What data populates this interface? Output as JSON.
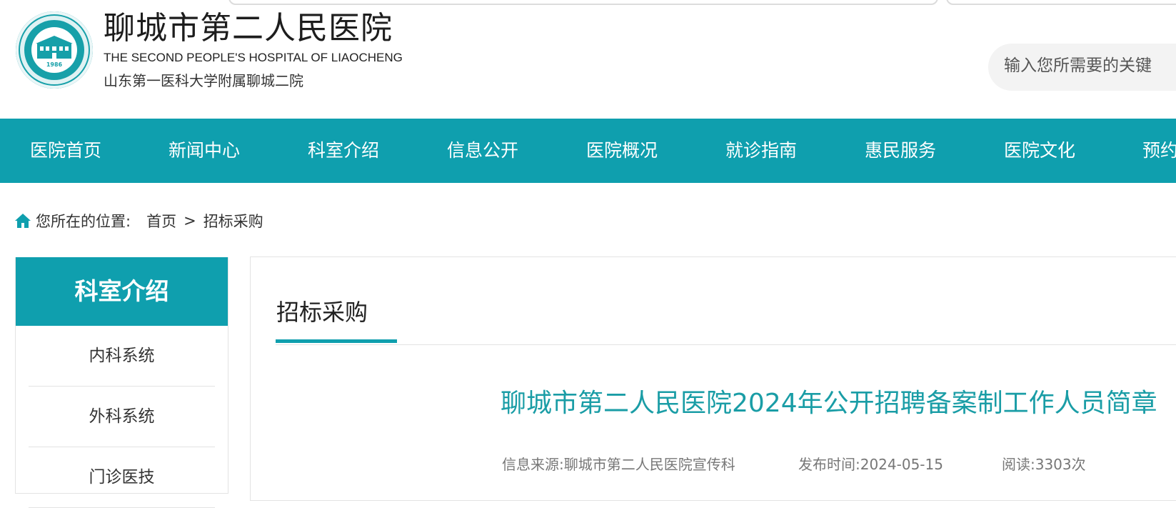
{
  "header": {
    "site_name": "聊城市第二人民医院",
    "site_name_en": "THE SECOND PEOPLE'S HOSPITAL OF LIAOCHENG",
    "site_subtitle": "山东第一医科大学附属聊城二院",
    "logo_year": "1986",
    "search_placeholder": "输入您所需要的关键"
  },
  "nav": {
    "items": [
      "医院首页",
      "新闻中心",
      "科室介绍",
      "信息公开",
      "医院概况",
      "就诊指南",
      "惠民服务",
      "医院文化",
      "预约"
    ]
  },
  "breadcrumb": {
    "prefix": "您所在的位置:",
    "home": "首页",
    "separator": ">",
    "current": "招标采购"
  },
  "sidebar": {
    "title": "科室介绍",
    "items": [
      "内科系统",
      "外科系统",
      "门诊医技"
    ]
  },
  "main": {
    "tab": "招标采购",
    "article_title": "聊城市第二人民医院2024年公开招聘备案制工作人员简章",
    "source": "信息来源:聊城市第二人民医院宣传科",
    "published": "发布时间:2024-05-15",
    "views": "阅读:3303次"
  },
  "colors": {
    "brand": "#0f9fae",
    "title_teal": "#1a9da6"
  },
  "icons": {
    "breadcrumb": "home-icon",
    "logo": "hospital-emblem"
  }
}
